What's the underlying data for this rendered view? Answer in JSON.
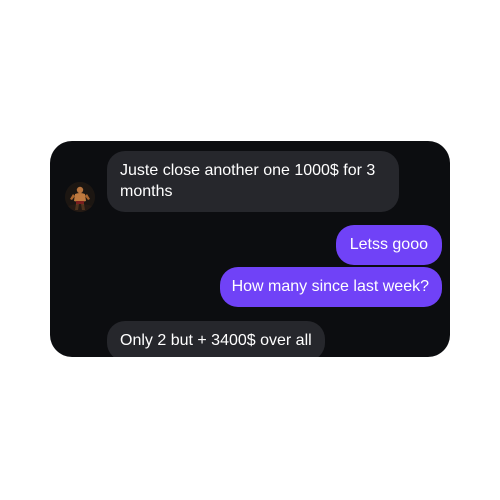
{
  "conversation": {
    "messages": [
      {
        "direction": "incoming",
        "text": "Juste close another one 1000$ for 3 months"
      },
      {
        "direction": "outgoing",
        "text": "Letss gooo"
      },
      {
        "direction": "outgoing",
        "text": "How many since last week?"
      },
      {
        "direction": "incoming",
        "text": "Only 2 but + 3400$ over all"
      }
    ]
  },
  "colors": {
    "background": "#0c0d10",
    "incoming_bubble": "#26272c",
    "outgoing_bubble": "#7042f7",
    "text": "#ffffff"
  },
  "icons": {
    "avatar": "contact-avatar"
  }
}
